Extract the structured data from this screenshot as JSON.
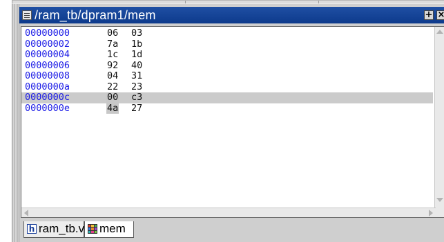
{
  "window": {
    "title": "/ram_tb/dpram1/mem",
    "title_icon": "memory-window-icon",
    "buttons": [
      {
        "name": "dock-icon",
        "glyph": "+"
      },
      {
        "name": "close-icon",
        "glyph": "×"
      }
    ]
  },
  "memory": {
    "selected_row": 6,
    "rows": [
      {
        "address": "00000000",
        "values": [
          "06",
          "03"
        ]
      },
      {
        "address": "00000002",
        "values": [
          "7a",
          "1b"
        ]
      },
      {
        "address": "00000004",
        "values": [
          "1c",
          "1d"
        ]
      },
      {
        "address": "00000006",
        "values": [
          "92",
          "40"
        ]
      },
      {
        "address": "00000008",
        "values": [
          "04",
          "31"
        ]
      },
      {
        "address": "0000000a",
        "values": [
          "22",
          "23"
        ]
      },
      {
        "address": "0000000c",
        "values": [
          "00",
          "c3"
        ]
      },
      {
        "address": "0000000e",
        "values": [
          "4a",
          "27"
        ]
      }
    ]
  },
  "tabs": [
    {
      "label": "ram_tb.v",
      "icon": "verilog-file-icon",
      "active": false
    },
    {
      "label": "mem",
      "icon": "memory-icon",
      "active": true
    }
  ],
  "colors": {
    "title_bar": "#1f4fa3",
    "address_text": "#1a1ae6",
    "selection": "#cbcbcb"
  }
}
